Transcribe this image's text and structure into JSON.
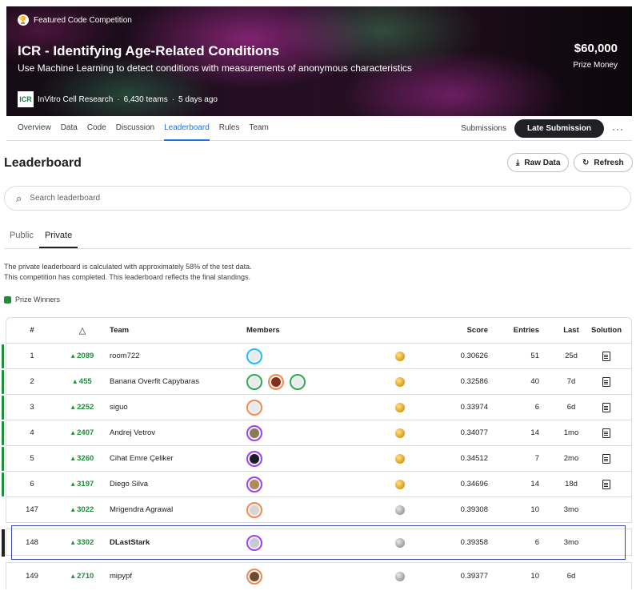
{
  "banner": {
    "featured": "Featured Code Competition",
    "title": "ICR - Identifying Age-Related Conditions",
    "subtitle": "Use Machine Learning to detect conditions with measurements of anonymous characteristics",
    "host_logo_text": "ICR",
    "host": "InVitro Cell Research",
    "teams": "6,430 teams",
    "time_ago": "5 days ago",
    "prize_amount": "$60,000",
    "prize_label": "Prize Money"
  },
  "nav": {
    "tabs": [
      "Overview",
      "Data",
      "Code",
      "Discussion",
      "Leaderboard",
      "Rules",
      "Team"
    ],
    "active_tab": "Leaderboard",
    "submissions": "Submissions",
    "late_submission": "Late Submission",
    "more": "···"
  },
  "leaderboard": {
    "title": "Leaderboard",
    "raw_data": "Raw Data",
    "refresh": "Refresh",
    "search_placeholder": "Search leaderboard",
    "tabs": [
      "Public",
      "Private"
    ],
    "active_tab": "Private",
    "note_line1": "The private leaderboard is calculated with approximately 58% of the test data.",
    "note_line2": "This competition has completed. This leaderboard reflects the final standings.",
    "prize_winners": "Prize Winners",
    "prize_color": "#1e8e3e",
    "columns": {
      "rank": "#",
      "delta": "△",
      "team": "Team",
      "members": "Members",
      "score": "Score",
      "entries": "Entries",
      "last": "Last",
      "solution": "Solution"
    },
    "rows": [
      {
        "rank": "1",
        "delta": "2089",
        "team": "room722",
        "medal": "gold",
        "score": "0.30626",
        "entries": "51",
        "last": "25d",
        "solution": true,
        "winner": true
      },
      {
        "rank": "2",
        "delta": "455",
        "team": "Banana Overfit Capybaras",
        "medal": "gold",
        "score": "0.32586",
        "entries": "40",
        "last": "7d",
        "solution": true,
        "winner": true
      },
      {
        "rank": "3",
        "delta": "2252",
        "team": "siguo",
        "medal": "gold",
        "score": "0.33974",
        "entries": "6",
        "last": "6d",
        "solution": true,
        "winner": true
      },
      {
        "rank": "4",
        "delta": "2407",
        "team": "Andrej Vetrov",
        "medal": "gold",
        "score": "0.34077",
        "entries": "14",
        "last": "1mo",
        "solution": true,
        "winner": true
      },
      {
        "rank": "5",
        "delta": "3260",
        "team": "Cihat Emre Çeliker",
        "medal": "gold",
        "score": "0.34512",
        "entries": "7",
        "last": "2mo",
        "solution": true,
        "winner": true
      },
      {
        "rank": "6",
        "delta": "3197",
        "team": "Diego Silva",
        "medal": "gold",
        "score": "0.34696",
        "entries": "14",
        "last": "18d",
        "solution": true,
        "winner": true
      },
      {
        "rank": "147",
        "delta": "3022",
        "team": "Mrigendra Agrawal",
        "medal": "silver",
        "score": "0.39308",
        "entries": "10",
        "last": "3mo",
        "solution": false,
        "winner": false
      }
    ],
    "my_row": {
      "rank": "148",
      "delta": "3302",
      "team": "DLastStark",
      "medal": "silver",
      "score": "0.39358",
      "entries": "6",
      "last": "3mo"
    },
    "next_row": {
      "rank": "149",
      "delta": "2710",
      "team": "mipypf",
      "medal": "silver",
      "score": "0.39377",
      "entries": "10",
      "last": "6d"
    }
  }
}
